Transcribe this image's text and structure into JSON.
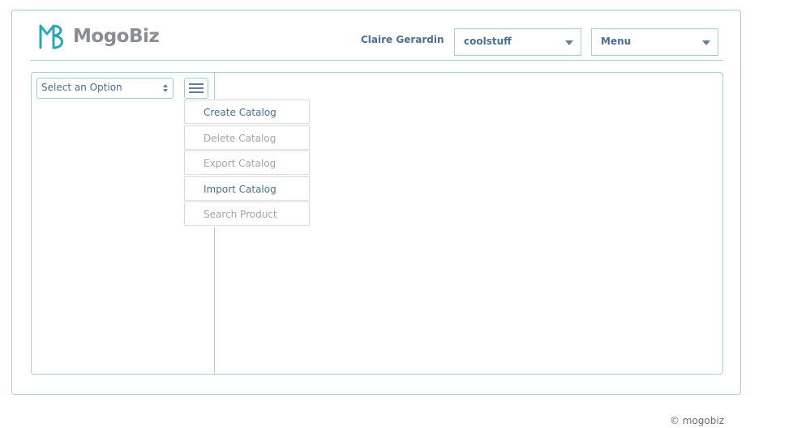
{
  "brand": {
    "name": "MogoBiz",
    "colors": {
      "accent": "#2aa5b8",
      "text": "#4a6f95",
      "border": "#a9cfdc"
    }
  },
  "header": {
    "user_name": "Claire Gerardin",
    "store_select": {
      "value": "coolstuff"
    },
    "menu_select": {
      "value": "Menu"
    }
  },
  "sidebar": {
    "option_select": {
      "value": "Select an Option"
    },
    "menu_button_icon": "hamburger-icon"
  },
  "catalog_menu": {
    "items": [
      {
        "label": "Create Catalog",
        "enabled": true
      },
      {
        "label": "Delete Catalog",
        "enabled": false
      },
      {
        "label": "Export Catalog",
        "enabled": false
      },
      {
        "label": "Import Catalog",
        "enabled": true
      },
      {
        "label": "Search Product",
        "enabled": false
      }
    ]
  },
  "footer": {
    "copyright": "© mogobiz"
  }
}
